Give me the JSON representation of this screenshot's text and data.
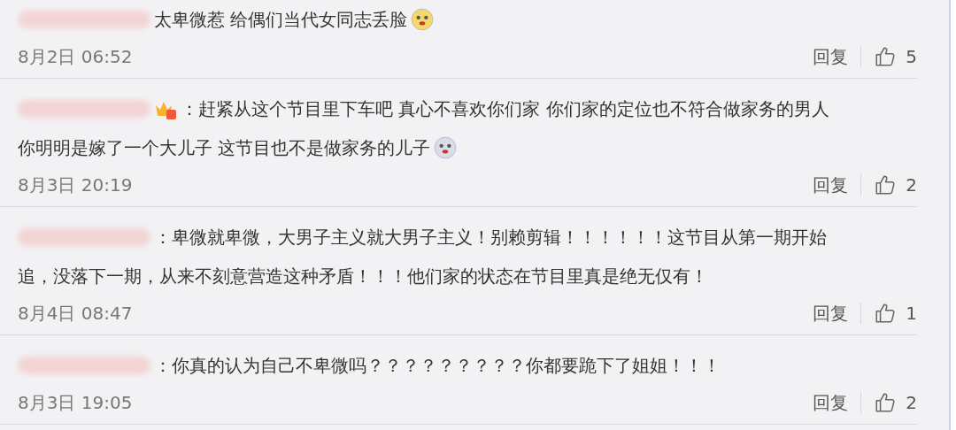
{
  "comments": [
    {
      "badge": false,
      "lines": [
        "太卑微惹 给偶们当代女同志丢脸"
      ],
      "emoji": true,
      "date": "8月2日 06:52",
      "reply": "回复",
      "likes": "5"
    },
    {
      "badge": true,
      "lines": [
        "：赶紧从这个节目里下车吧 真心不喜欢你们家 你们家的定位也不符合做家务的男人",
        "你明明是嫁了一个大儿子 这节目也不是做家务的儿子"
      ],
      "emoji": true,
      "date": "8月3日 20:19",
      "reply": "回复",
      "likes": "2"
    },
    {
      "badge": false,
      "lines": [
        "：卑微就卑微，大男子主义就大男子主义！别赖剪辑！！！！！！这节目从第一期开始",
        "追，没落下一期，从来不刻意营造这种矛盾！！！他们家的状态在节目里真是绝无仅有！"
      ],
      "emoji": false,
      "date": "8月4日 08:47",
      "reply": "回复",
      "likes": "1"
    },
    {
      "badge": false,
      "lines": [
        "：你真的认为自己不卑微吗？？？？？？？？？你都要跪下了姐姐！！！"
      ],
      "emoji": false,
      "date": "8月3日 19:05",
      "reply": "回复",
      "likes": "2"
    }
  ]
}
